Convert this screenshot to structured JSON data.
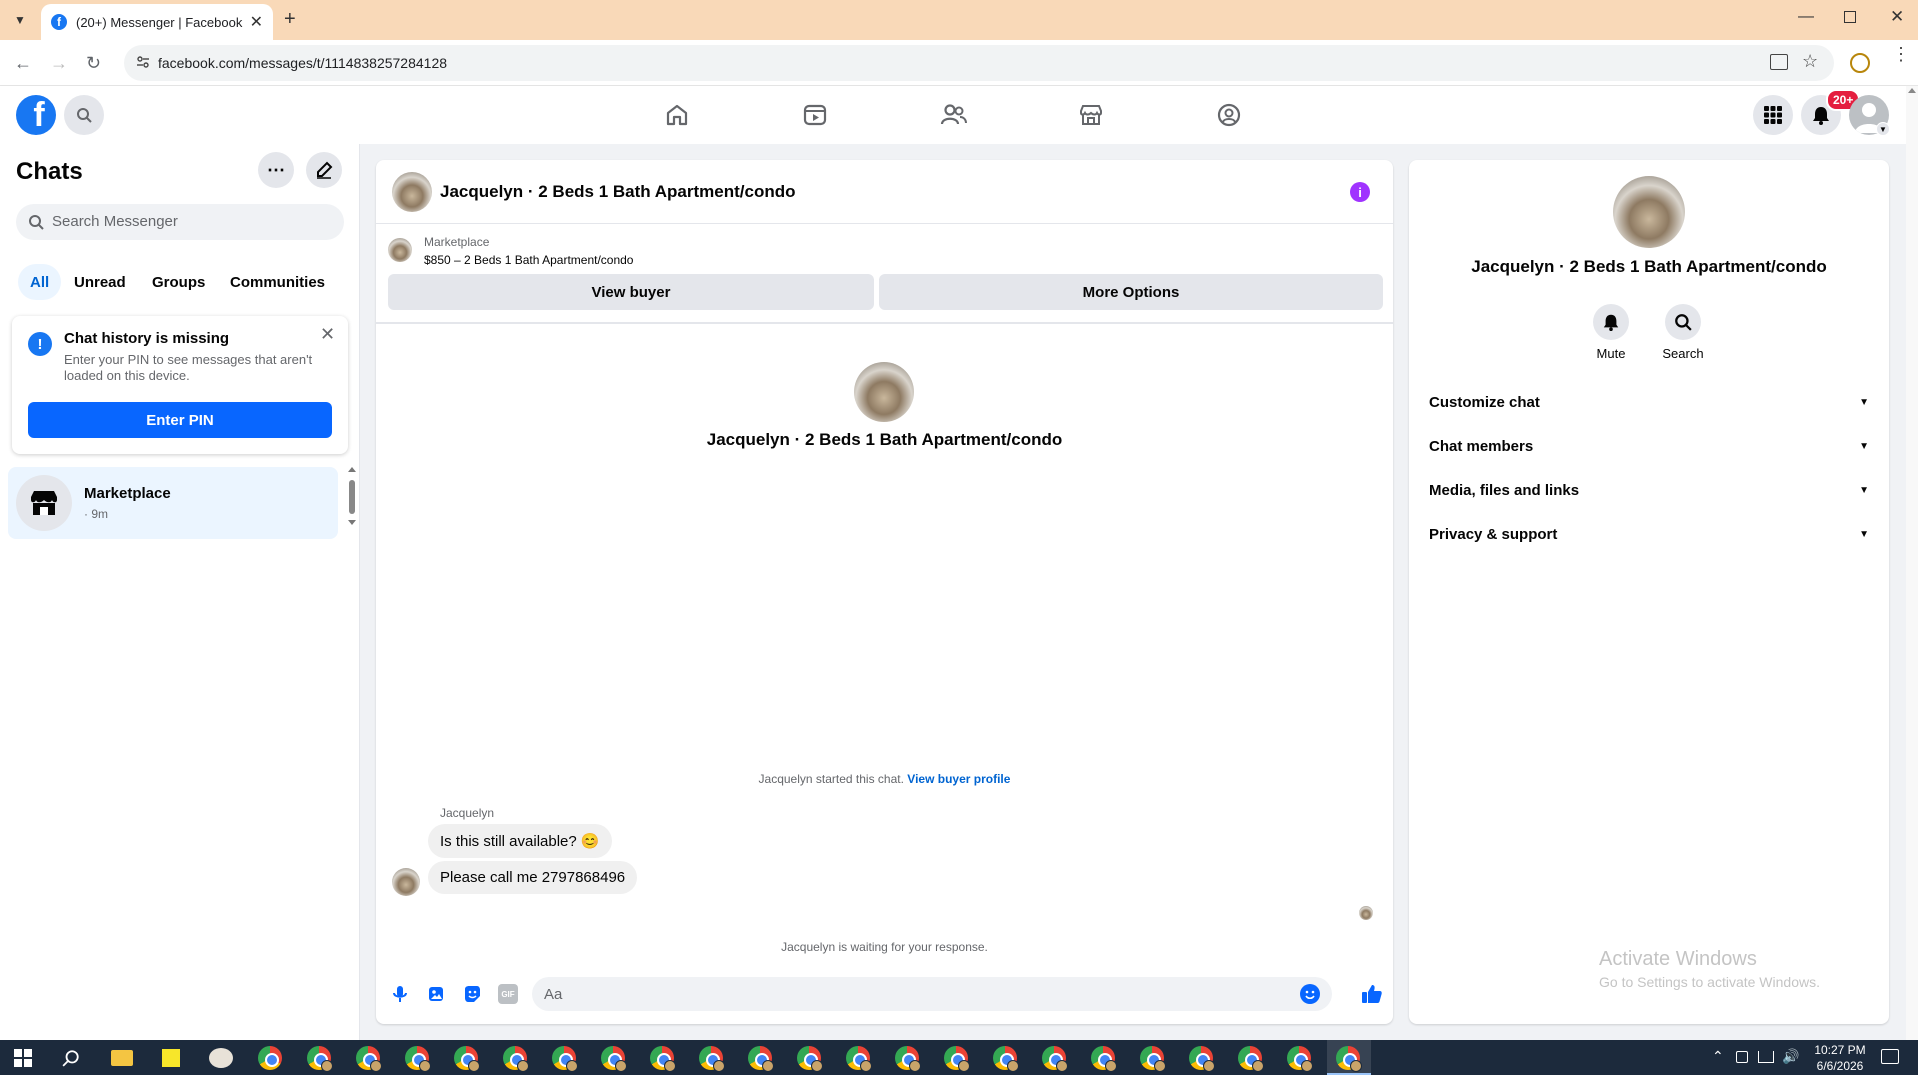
{
  "browser": {
    "tab_title": "(20+) Messenger | Facebook",
    "url": "facebook.com/messages/t/1114838257284128"
  },
  "header": {
    "notifications_badge": "20+"
  },
  "sidebar": {
    "title": "Chats",
    "search_placeholder": "Search Messenger",
    "filters": [
      "All",
      "Unread",
      "Groups",
      "Communities"
    ],
    "alert": {
      "title": "Chat history is missing",
      "body": "Enter your PIN to see messages that aren't loaded on this device.",
      "button": "Enter PIN"
    },
    "chats": [
      {
        "name": "Marketplace",
        "meta": "· 9m"
      }
    ]
  },
  "conversation": {
    "title": "Jacquelyn · 2 Beds 1 Bath Apartment/condo",
    "listing": {
      "source": "Marketplace",
      "detail": "$850 – 2 Beds 1 Bath Apartment/condo",
      "view_buyer": "View buyer",
      "more_options": "More Options"
    },
    "intro_name": "Jacquelyn · 2 Beds 1 Bath Apartment/condo",
    "started_text": "Jacquelyn started this chat.",
    "view_profile_link": "View buyer profile",
    "sender_name": "Jacquelyn",
    "messages": [
      {
        "text": "Is this still available? 😊"
      },
      {
        "text": "Please call me 2797868496"
      }
    ],
    "waiting_text": "Jacquelyn is waiting for your response.",
    "composer_placeholder": "Aa"
  },
  "details": {
    "name": "Jacquelyn · 2 Beds 1 Bath Apartment/condo",
    "actions": [
      "Mute",
      "Search"
    ],
    "sections": [
      "Customize chat",
      "Chat members",
      "Media, files and links",
      "Privacy & support"
    ]
  },
  "watermark": {
    "line1": "Activate Windows",
    "line2": "Go to Settings to activate Windows."
  },
  "taskbar": {
    "time": "10:27 PM",
    "date": "6/6/2026"
  },
  "colors": {
    "fb_blue": "#1877f2",
    "accent_purple": "#a033ff",
    "tab_strip": "#f9d9b8"
  }
}
